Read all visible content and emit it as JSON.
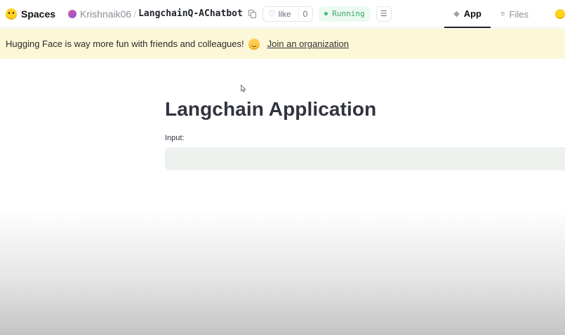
{
  "header": {
    "brand": "Spaces",
    "owner": "Krishnaik06",
    "separator": "/",
    "repo": "LangchainQ-AChatbot",
    "like_label": "like",
    "like_count": "0",
    "status": "Running",
    "tabs": [
      {
        "label": "App",
        "icon": "cube-icon",
        "active": true
      },
      {
        "label": "Files",
        "icon": "files-icon",
        "active": false
      }
    ]
  },
  "banner": {
    "text": "Hugging Face is way more fun with friends and colleagues!",
    "link": "Join an organization"
  },
  "app": {
    "title": "Langchain Application",
    "input_label": "Input:",
    "input_value": ""
  },
  "colors": {
    "banner_bg": "#fbf7d7",
    "status_green": "#3aa56b",
    "input_bg": "#eef2ef",
    "title_color": "#31333f"
  }
}
